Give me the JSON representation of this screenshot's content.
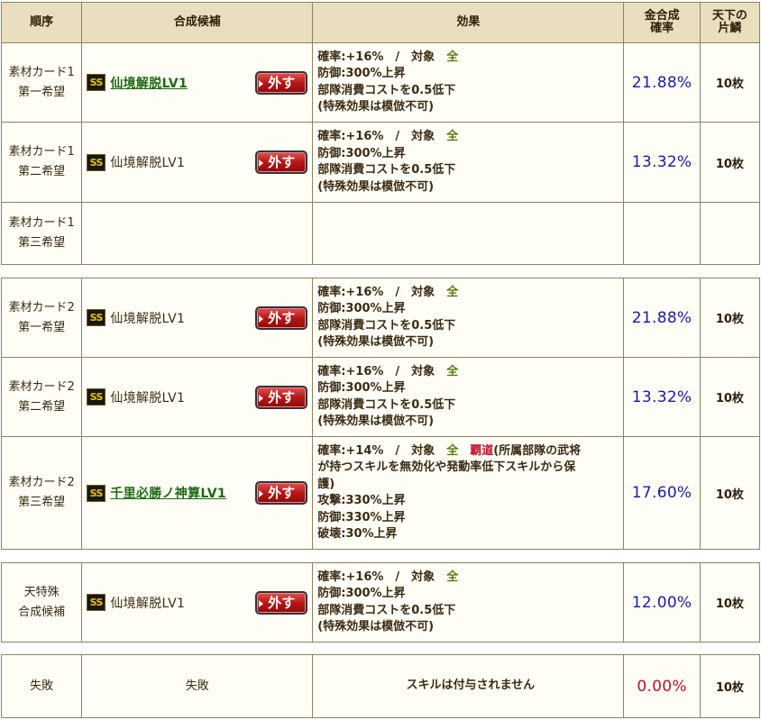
{
  "header": {
    "order": "順序",
    "candidate": "合成候補",
    "effect": "効果",
    "rate_line1": "金合成",
    "rate_line2": "確率",
    "scale_line1": "天下の",
    "scale_line2": "片鱗"
  },
  "remove_label": "外す",
  "ss_label": "SS",
  "group1": {
    "rows": [
      {
        "order1": "素材カード1",
        "order2": "第一希望",
        "skill": "仙境解脱LV1",
        "effect": {
          "l1a": "確率:+16%　/　対象　",
          "l1b": "全",
          "l2": "防御:300%上昇",
          "l3": "部隊消費コストを0.5低下",
          "l4": "(特殊効果は模倣不可)"
        },
        "rate": "21.88%",
        "count": "10枚"
      },
      {
        "order1": "素材カード1",
        "order2": "第二希望",
        "skill": "仙境解脱LV1",
        "effect": {
          "l1a": "確率:+16%　/　対象　",
          "l1b": "全",
          "l2": "防御:300%上昇",
          "l3": "部隊消費コストを0.5低下",
          "l4": "(特殊効果は模倣不可)"
        },
        "rate": "13.32%",
        "count": "10枚"
      },
      {
        "order1": "素材カード1",
        "order2": "第三希望"
      }
    ]
  },
  "group2": {
    "rows": [
      {
        "order1": "素材カード2",
        "order2": "第一希望",
        "skill": "仙境解脱LV1",
        "effect": {
          "l1a": "確率:+16%　/　対象　",
          "l1b": "全",
          "l2": "防御:300%上昇",
          "l3": "部隊消費コストを0.5低下",
          "l4": "(特殊効果は模倣不可)"
        },
        "rate": "21.88%",
        "count": "10枚"
      },
      {
        "order1": "素材カード2",
        "order2": "第二希望",
        "skill": "仙境解脱LV1",
        "effect": {
          "l1a": "確率:+16%　/　対象　",
          "l1b": "全",
          "l2": "防御:300%上昇",
          "l3": "部隊消費コストを0.5低下",
          "l4": "(特殊効果は模倣不可)"
        },
        "rate": "13.32%",
        "count": "10枚"
      },
      {
        "order1": "素材カード2",
        "order2": "第三希望",
        "skill": "千里必勝ノ神算LV1",
        "effect": {
          "l1a": "確率:+14%　/　対象　",
          "l1b": "全",
          "l1c": "覇道",
          "l1d": "(所属部隊の武将",
          "l2": "が持つスキルを無効化や発動率低下スキルから保",
          "l3": "護)",
          "l4": "攻撃:330%上昇",
          "l5": "防御:330%上昇",
          "l6": "破壊:30%上昇"
        },
        "rate": "17.60%",
        "count": "10枚"
      }
    ]
  },
  "group3": {
    "rows": [
      {
        "order1": "天特殊",
        "order2": "合成候補",
        "skill": "仙境解脱LV1",
        "effect": {
          "l1a": "確率:+16%　/　対象　",
          "l1b": "全",
          "l2": "防御:300%上昇",
          "l3": "部隊消費コストを0.5低下",
          "l4": "(特殊効果は模倣不可)"
        },
        "rate": "12.00%",
        "count": "10枚"
      }
    ]
  },
  "group4": {
    "rows": [
      {
        "order": "失敗",
        "candidate": "失敗",
        "effect": "スキルは付与されません",
        "rate": "0.00%",
        "count": "10枚"
      }
    ]
  },
  "colors": {
    "header_bg": "#e9dfbe",
    "cell_bg": "#fffef6",
    "border": "#8c8161",
    "rate_blue": "#1a1aa6",
    "fail_red": "#c0102a",
    "link_green": "#1b6a12",
    "button_red": "#b81616"
  }
}
